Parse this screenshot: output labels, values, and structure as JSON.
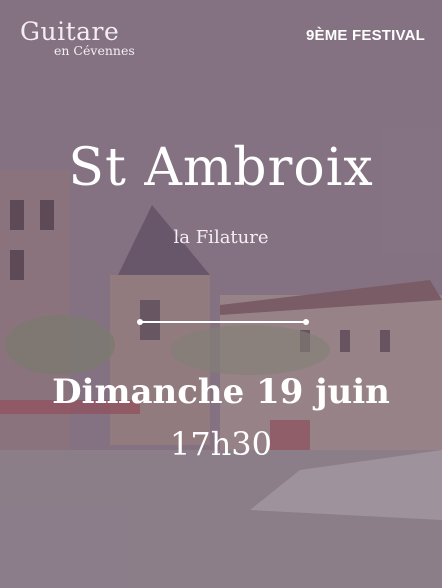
{
  "logo": {
    "main": "Guitare",
    "sub": "en Cévennes"
  },
  "festival_label": "9ÈME FESTIVAL",
  "title": "St Ambroix",
  "venue": "la Filature",
  "date": "Dimanche 19 juin",
  "time": "17h30",
  "colors": {
    "overlay": "#5f465f",
    "text": "#ffffff"
  }
}
